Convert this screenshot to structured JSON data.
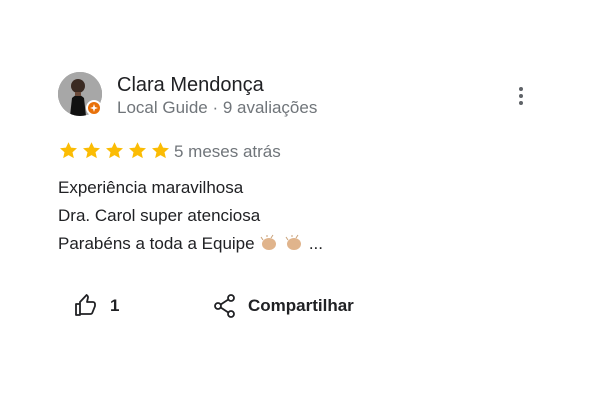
{
  "reviewer": {
    "name": "Clara Mendonça",
    "meta": "Local Guide · 9 avaliações"
  },
  "rating": {
    "stars": 5,
    "max": 5,
    "time": "5 meses atrás"
  },
  "review": {
    "lines": [
      "Experiência maravilhosa",
      "Dra. Carol super atenciosa",
      "Parabéns a toda a Equipe"
    ],
    "emoji": "👏🏼👏🏼",
    "ellipsis": "..."
  },
  "actions": {
    "like_count": "1",
    "share_label": "Compartilhar"
  },
  "colors": {
    "star": "#fbbc04",
    "badge": "#e8710a",
    "secondary_text": "#70757a"
  },
  "icons": [
    "thumbs-up-icon",
    "share-icon",
    "more-vert-icon",
    "local-guide-badge-icon"
  ]
}
